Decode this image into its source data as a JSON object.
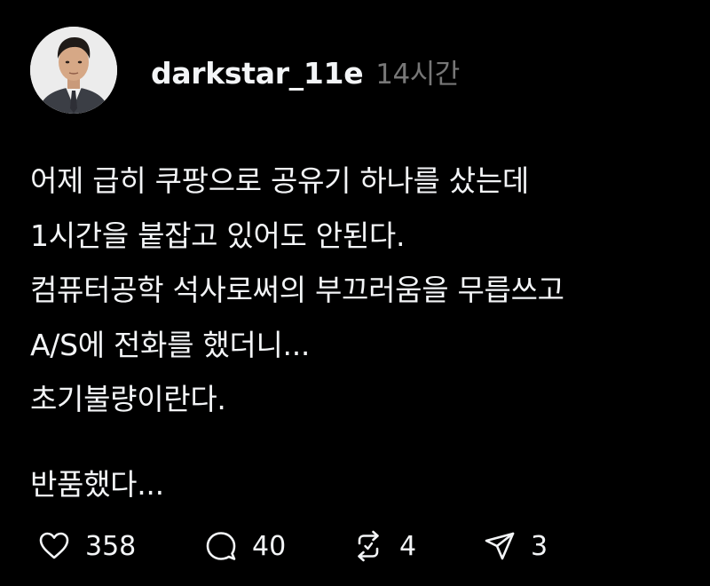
{
  "post": {
    "username": "darkstar_11e",
    "timestamp": "14시간",
    "lines": [
      "어제 급히 쿠팡으로 공유기 하나를 샀는데",
      "1시간을 붙잡고 있어도 안된다.",
      "컴퓨터공학 석사로써의 부끄러움을 무릅쓰고",
      "A/S에 전화를 했더니...",
      "초기불량이란다."
    ],
    "closing_line": "반품했다...",
    "actions": {
      "likes": "358",
      "replies": "40",
      "reposts": "4",
      "shares": "3"
    }
  },
  "colors": {
    "background": "#000000",
    "text": "#f3f5f7",
    "muted": "#777777"
  },
  "icons": {
    "like": "heart-icon",
    "reply": "speech-bubble-icon",
    "repost": "repost-arrows-icon",
    "share": "paper-plane-icon"
  }
}
